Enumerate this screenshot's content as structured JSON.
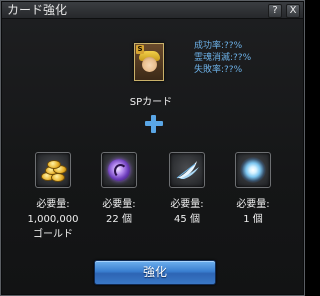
{
  "window": {
    "title": "カード強化",
    "help_label": "?",
    "close_label": "X"
  },
  "card": {
    "level_badge": "S",
    "name": "SPカード",
    "rates": {
      "success": "成功率:??%",
      "soul_loss": "霊魂消滅:??%",
      "failure": "失敗率:??%"
    }
  },
  "materials": [
    {
      "icon": "gold-coins-icon",
      "label": "必要量:",
      "amount": "1,000,000",
      "unit": "ゴールド"
    },
    {
      "icon": "purple-soul-orb-icon",
      "label": "必要量:",
      "amount": "22 個",
      "unit": ""
    },
    {
      "icon": "white-feather-icon",
      "label": "必要量:",
      "amount": "45 個",
      "unit": ""
    },
    {
      "icon": "light-burst-icon",
      "label": "必要量:",
      "amount": "1 個",
      "unit": ""
    }
  ],
  "actions": {
    "enhance_label": "強化"
  },
  "colors": {
    "accent_blue": "#5aa6e6",
    "rate_text": "#6cb0e6",
    "button": "#3a7fd0"
  }
}
